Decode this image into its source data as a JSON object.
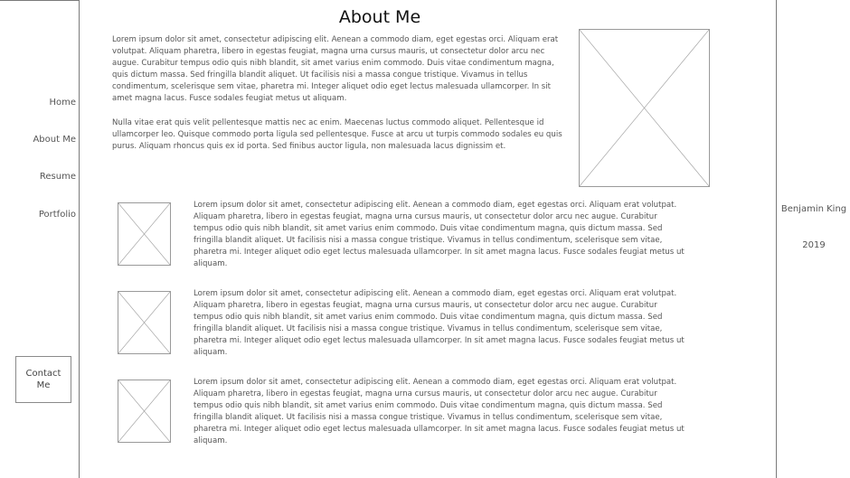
{
  "sidebar": {
    "nav_items": [
      {
        "label": "Home"
      },
      {
        "label": "About Me"
      },
      {
        "label": "Resume"
      },
      {
        "label": "Portfolio"
      }
    ],
    "contact_button_label": "Contact Me"
  },
  "main": {
    "title": "About Me",
    "intro_paragraphs": [
      "Lorem ipsum dolor sit amet, consectetur adipiscing elit. Aenean a commodo diam, eget egestas orci. Aliquam erat volutpat. Aliquam pharetra, libero in egestas feugiat, magna urna cursus mauris, ut consectetur dolor arcu nec augue. Curabitur tempus odio quis nibh blandit, sit amet varius enim commodo. Duis vitae condimentum magna, quis dictum massa. Sed fringilla blandit aliquet. Ut facilisis nisi a massa congue tristique. Vivamus in tellus condimentum, scelerisque sem vitae, pharetra mi. Integer aliquet odio eget lectus malesuada ullamcorper. In sit amet magna lacus. Fusce sodales feugiat metus ut aliquam.",
      "Nulla vitae erat quis velit pellentesque mattis nec ac enim. Maecenas luctus commodo aliquet. Pellentesque id ullamcorper leo. Quisque commodo porta ligula sed pellentesque. Fusce at arcu ut turpis commodo sodales eu quis purus. Aliquam rhoncus quis ex id porta. Sed finibus auctor ligula, non malesuada lacus dignissim et."
    ],
    "items": [
      {
        "text": "Lorem ipsum dolor sit amet, consectetur adipiscing elit. Aenean a commodo diam, eget egestas orci. Aliquam erat volutpat. Aliquam pharetra, libero in egestas feugiat, magna urna cursus mauris, ut consectetur dolor arcu nec augue. Curabitur tempus odio quis nibh blandit, sit amet varius enim commodo. Duis vitae condimentum magna, quis dictum massa. Sed fringilla blandit aliquet. Ut facilisis nisi a massa congue tristique. Vivamus in tellus condimentum, scelerisque sem vitae, pharetra mi. Integer aliquet odio eget lectus malesuada ullamcorper. In sit amet magna lacus. Fusce sodales feugiat metus ut aliquam."
      },
      {
        "text": "Lorem ipsum dolor sit amet, consectetur adipiscing elit. Aenean a commodo diam, eget egestas orci. Aliquam erat volutpat. Aliquam pharetra, libero in egestas feugiat, magna urna cursus mauris, ut consectetur dolor arcu nec augue. Curabitur tempus odio quis nibh blandit, sit amet varius enim commodo. Duis vitae condimentum magna, quis dictum massa. Sed fringilla blandit aliquet. Ut facilisis nisi a massa congue tristique. Vivamus in tellus condimentum, scelerisque sem vitae, pharetra mi. Integer aliquet odio eget lectus malesuada ullamcorper. In sit amet magna lacus. Fusce sodales feugiat metus ut aliquam."
      },
      {
        "text": "Lorem ipsum dolor sit amet, consectetur adipiscing elit. Aenean a commodo diam, eget egestas orci. Aliquam erat volutpat. Aliquam pharetra, libero in egestas feugiat, magna urna cursus mauris, ut consectetur dolor arcu nec augue. Curabitur tempus odio quis nibh blandit, sit amet varius enim commodo. Duis vitae condimentum magna, quis dictum massa. Sed fringilla blandit aliquet. Ut facilisis nisi a massa congue tristique. Vivamus in tellus condimentum, scelerisque sem vitae, pharetra mi. Integer aliquet odio eget lectus malesuada ullamcorper. In sit amet magna lacus. Fusce sodales feugiat metus ut aliquam."
      }
    ]
  },
  "right_sidebar": {
    "author": "Benjamin King",
    "year": "2019"
  },
  "colors": {
    "border": "#7a7a7a",
    "text": "#555555",
    "title": "#111111"
  }
}
